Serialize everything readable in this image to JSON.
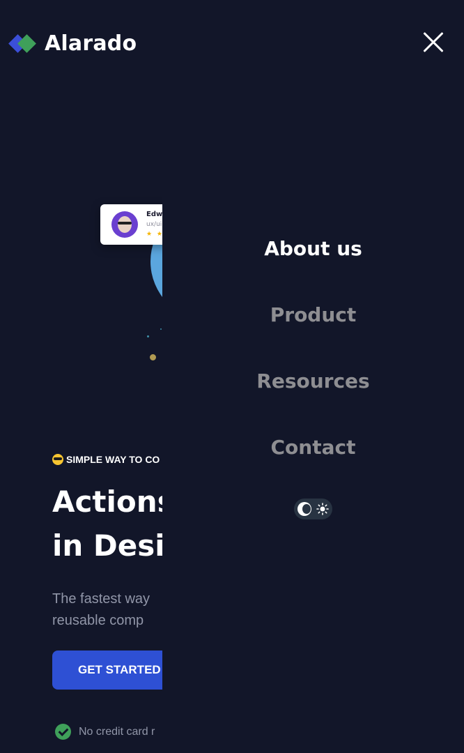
{
  "header": {
    "brand": "Alarado",
    "logo_icon": "diamond-logo-icon",
    "close_icon": "close-icon"
  },
  "background": {
    "review": {
      "name": "Edwi",
      "role": "ux/ui",
      "stars": "★ ★"
    },
    "tagline": "SIMPLE WAY TO CO",
    "title_lines": [
      "Actions",
      "in Desig"
    ],
    "subtitle_lines": [
      "The fastest way",
      "reusable comp"
    ],
    "cta_label": "GET STARTED",
    "note": "No credit card r"
  },
  "menu": {
    "items": [
      {
        "label": "About us",
        "active": true
      },
      {
        "label": "Product",
        "active": false
      },
      {
        "label": "Resources",
        "active": false
      },
      {
        "label": "Contact",
        "active": false
      }
    ],
    "theme_toggle": {
      "icons": [
        "moon-icon",
        "sun-icon"
      ]
    }
  },
  "colors": {
    "background": "#121629",
    "accent_blue": "#2e50d4",
    "accent_green": "#3fa05a",
    "menu_inactive": "#8e8e92"
  }
}
